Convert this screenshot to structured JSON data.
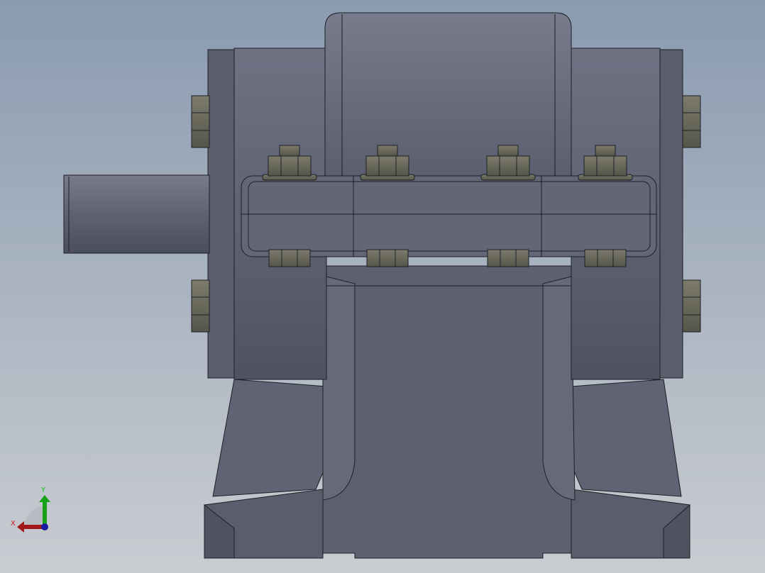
{
  "viewport": {
    "model": "gearbox-assembly",
    "view": "front"
  },
  "triad": {
    "x_label": "X",
    "y_label": "Y",
    "x_color": "#a01818",
    "y_color": "#18a018",
    "z_color": "#1a1aa0"
  },
  "colors": {
    "body": "#5d6171",
    "body_light": "#6f7384",
    "body_dark": "#4c505e",
    "bolt": "#6a6a5e",
    "edge": "#1e1f26"
  }
}
